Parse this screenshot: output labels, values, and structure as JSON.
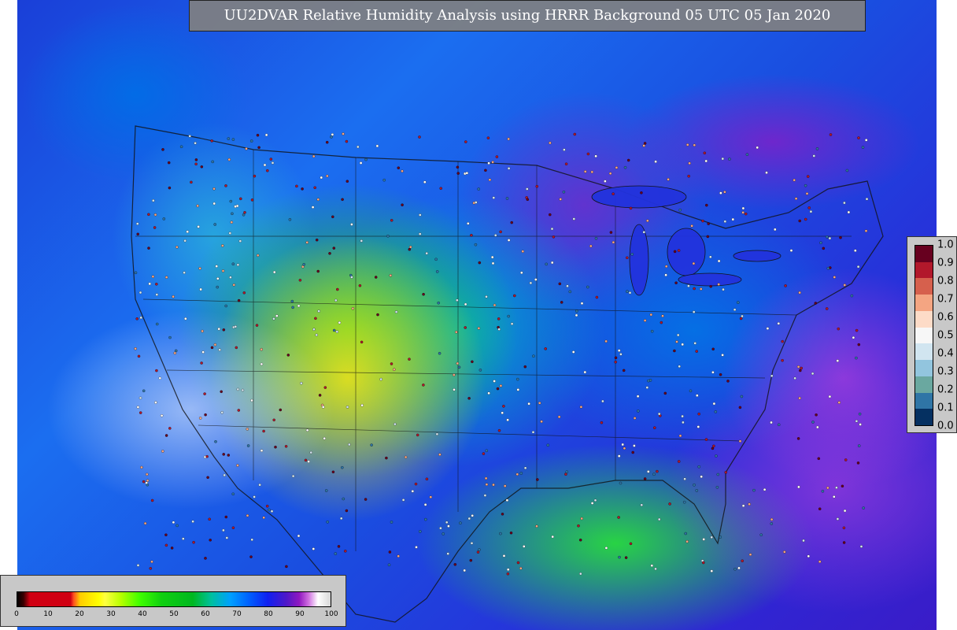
{
  "header": {
    "title": "UU2DVAR Relative Humidity Analysis using HRRR Background 05 UTC 05 Jan 2020"
  },
  "colorbars": {
    "relative_humidity": {
      "ticks": [
        "0",
        "10",
        "20",
        "30",
        "40",
        "50",
        "60",
        "70",
        "80",
        "90",
        "100"
      ],
      "range": [
        0,
        100
      ]
    },
    "station_markers": {
      "ticks": [
        "1.0",
        "0.9",
        "0.8",
        "0.7",
        "0.6",
        "0.5",
        "0.4",
        "0.3",
        "0.2",
        "0.1",
        "0.0"
      ],
      "range": [
        0.0,
        1.0
      ],
      "colors": [
        "#67001f",
        "#b2182b",
        "#d6604d",
        "#f4a582",
        "#fddbc7",
        "#f7f7f7",
        "#d1e5f0",
        "#92c5de",
        "#6aa8a0",
        "#2f75a6",
        "#053061"
      ]
    }
  },
  "map": {
    "region": "CONUS",
    "station_marker_count_estimate": 4000
  }
}
